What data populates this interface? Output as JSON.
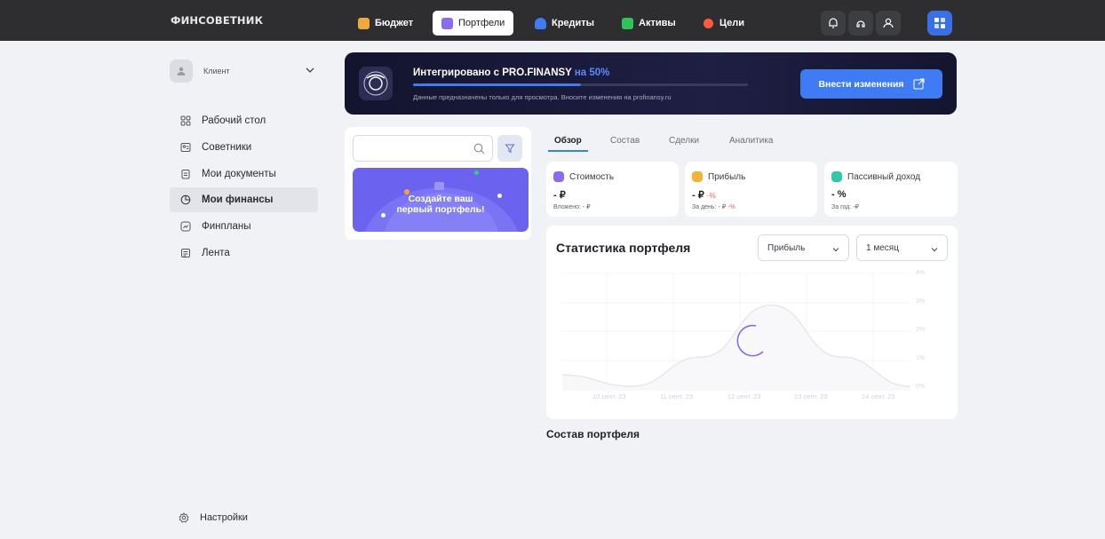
{
  "app": {
    "logo": "ФИНСОВЕТНИК"
  },
  "topnav": [
    {
      "label": "Бюджет",
      "icon": "money-bag-icon",
      "color": "#f2a93b",
      "active": false
    },
    {
      "label": "Портфели",
      "icon": "briefcase-icon",
      "color": "#8a6cf0",
      "active": true
    },
    {
      "label": "Кредиты",
      "icon": "bank-icon",
      "color": "#3f7cf4",
      "active": false
    },
    {
      "label": "Активы",
      "icon": "chart-icon",
      "color": "#2fc35a",
      "active": false
    },
    {
      "label": "Цели",
      "icon": "target-icon",
      "color": "#ff5a3c",
      "active": false
    }
  ],
  "topbar_buttons": [
    "bell-icon",
    "support-icon",
    "user-icon",
    "apps-grid-icon"
  ],
  "sidebar": {
    "client_label": "Клиент",
    "items": [
      {
        "label": "Рабочий стол",
        "icon": "dashboard-icon",
        "active": false
      },
      {
        "label": "Советники",
        "icon": "advisors-icon",
        "active": false
      },
      {
        "label": "Мои документы",
        "icon": "documents-icon",
        "active": false
      },
      {
        "label": "Мои финансы",
        "icon": "finance-pie-icon",
        "active": true
      },
      {
        "label": "Финпланы",
        "icon": "finplan-icon",
        "active": false
      },
      {
        "label": "Лента",
        "icon": "feed-icon",
        "active": false
      }
    ],
    "settings_label": "Настройки"
  },
  "banner": {
    "title_prefix": "Интегрировано с PRO.FINANSY",
    "title_pct": "на 50%",
    "progress": 0.5,
    "subtitle": "Данные предназначены только для просмотра. Вносите изменения на profinansy.ru",
    "button_label": "Внести изменения",
    "badge_text": "PRO.FINANSY"
  },
  "portfolio_list": {
    "search_placeholder": "",
    "promo_line1": "Создайте ваш",
    "promo_line2": "первый портфель!"
  },
  "tabs": [
    "Обзор",
    "Состав",
    "Сделки",
    "Аналитика"
  ],
  "stats": [
    {
      "title": "Стоимость",
      "icon": "wallet-icon",
      "icon_color": "#8a6cf0",
      "value": "- ₽",
      "value_delta": "",
      "sub_label": "Вложено: - ₽",
      "sub_delta": ""
    },
    {
      "title": "Прибыль",
      "icon": "profit-icon",
      "icon_color": "#f2b23b",
      "value": "- ₽",
      "value_delta": "-%",
      "sub_label": "За день: - ₽",
      "sub_delta": "-%"
    },
    {
      "title": "Пассивный доход",
      "icon": "passive-income-icon",
      "icon_color": "#34c7a5",
      "value": "- %",
      "value_delta": "",
      "sub_label": "За год: -₽",
      "sub_delta": ""
    }
  ],
  "statistics": {
    "title": "Статистика портфеля",
    "metric_select": "Прибыль",
    "period_select": "1 месяц"
  },
  "chart_data": {
    "type": "area",
    "x": [
      "10 сент. 23",
      "11 сент. 23",
      "12 сент. 23",
      "13 сент. 23",
      "14 сент. 23"
    ],
    "y_ticks": [
      "4%",
      "3%",
      "2%",
      "1%",
      "0%",
      "-1%"
    ],
    "series": [
      {
        "values": [
          -0.5,
          -1.0,
          0.3,
          2.6,
          0.3,
          -1.0
        ]
      }
    ],
    "ylim": [
      -1.2,
      4
    ],
    "grid": true
  },
  "composition_title": "Состав портфеля"
}
